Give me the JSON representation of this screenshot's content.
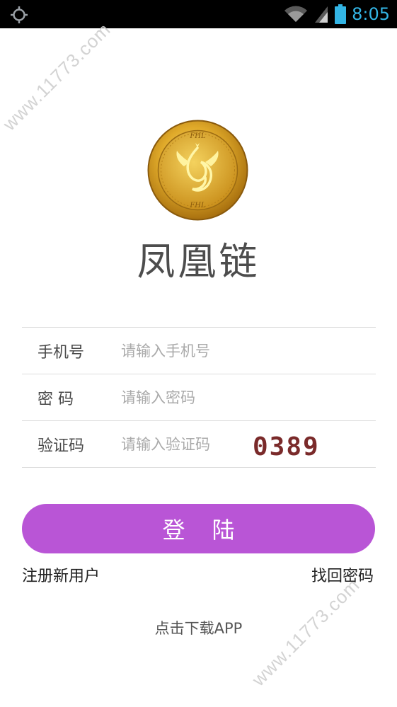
{
  "status_bar": {
    "time": "8:05",
    "icons": [
      "gps-icon",
      "wifi-icon",
      "signal-icon",
      "battery-icon"
    ]
  },
  "watermark": {
    "text": "www.11773.com"
  },
  "app": {
    "name": "凤凰链",
    "logo_text": "FHL"
  },
  "form": {
    "phone": {
      "label": "手机号",
      "placeholder": "请输入手机号"
    },
    "password": {
      "label": "密 码",
      "placeholder": "请输入密码"
    },
    "captcha": {
      "label": "验证码",
      "placeholder": "请输入验证码",
      "image_text": "0389"
    }
  },
  "actions": {
    "login_label": "登陆",
    "register_label": "注册新用户",
    "forgot_label": "找回密码",
    "download_label": "点击下载APP"
  },
  "colors": {
    "status_accent": "#33b5e5",
    "login_button": "#b955d6",
    "coin_gold": "#d9a521"
  }
}
